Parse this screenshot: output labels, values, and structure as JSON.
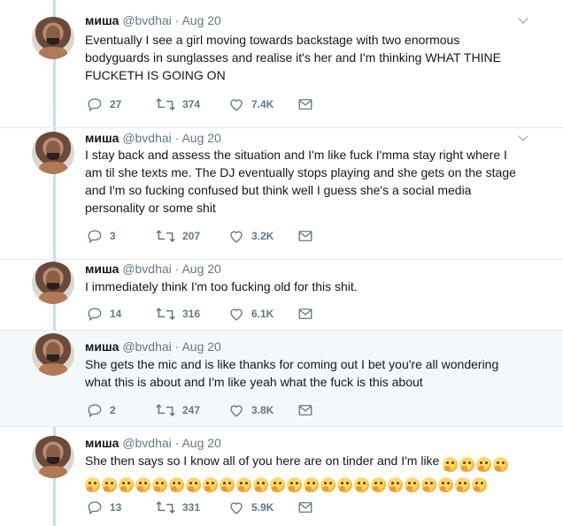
{
  "tweets": [
    {
      "name": "миша",
      "handle": "@bvdhai",
      "sep": "·",
      "date": "Aug 20",
      "text": "Eventually I see a girl moving towards backstage with two enormous\nbodyguards in sunglasses and realise it's her and I'm thinking WHAT THINE\nFUCKETH IS GOING ON",
      "replies": "27",
      "retweets": "374",
      "likes": "7.4K"
    },
    {
      "name": "миша",
      "handle": "@bvdhai",
      "sep": "·",
      "date": "Aug 20",
      "text": "I stay back and assess the situation and I'm like fuck I'mma stay right where I\nam til she texts me. The DJ eventually stops playing and she gets on the stage\nand I'm so fucking confused but think well I guess she's a social media\npersonality or some shit",
      "replies": "3",
      "retweets": "207",
      "likes": "3.2K"
    },
    {
      "name": "миша",
      "handle": "@bvdhai",
      "sep": "·",
      "date": "Aug 20",
      "text": "I immediately think I'm too fucking old for this shit.",
      "replies": "14",
      "retweets": "316",
      "likes": "6.1K"
    },
    {
      "name": "миша",
      "handle": "@bvdhai",
      "sep": "·",
      "date": "Aug 20",
      "text": "She gets the mic and is like thanks for coming out I bet you're all wondering\nwhat this is about and I'm like yeah what the fuck is this about",
      "replies": "2",
      "retweets": "247",
      "likes": "3.8K"
    },
    {
      "name": "миша",
      "handle": "@bvdhai",
      "sep": "·",
      "date": "Aug 20",
      "text": "She then says so I know all of you here are on tinder and I'm like",
      "emoji_name": "thinking-face-emoji",
      "emoji_count_line1": 4,
      "emoji_count_line2": 24,
      "replies": "13",
      "retweets": "331",
      "likes": "5.9K"
    }
  ],
  "icons": {
    "reply": "reply-icon",
    "retweet": "retweet-icon",
    "like": "heart-icon",
    "dm": "envelope-icon",
    "more": "chevron-down-icon"
  },
  "colors": {
    "thread_line": "#c4dff5",
    "muted": "#657786",
    "highlight_bg": "#f5f8fa",
    "border": "#e6ecf0"
  }
}
